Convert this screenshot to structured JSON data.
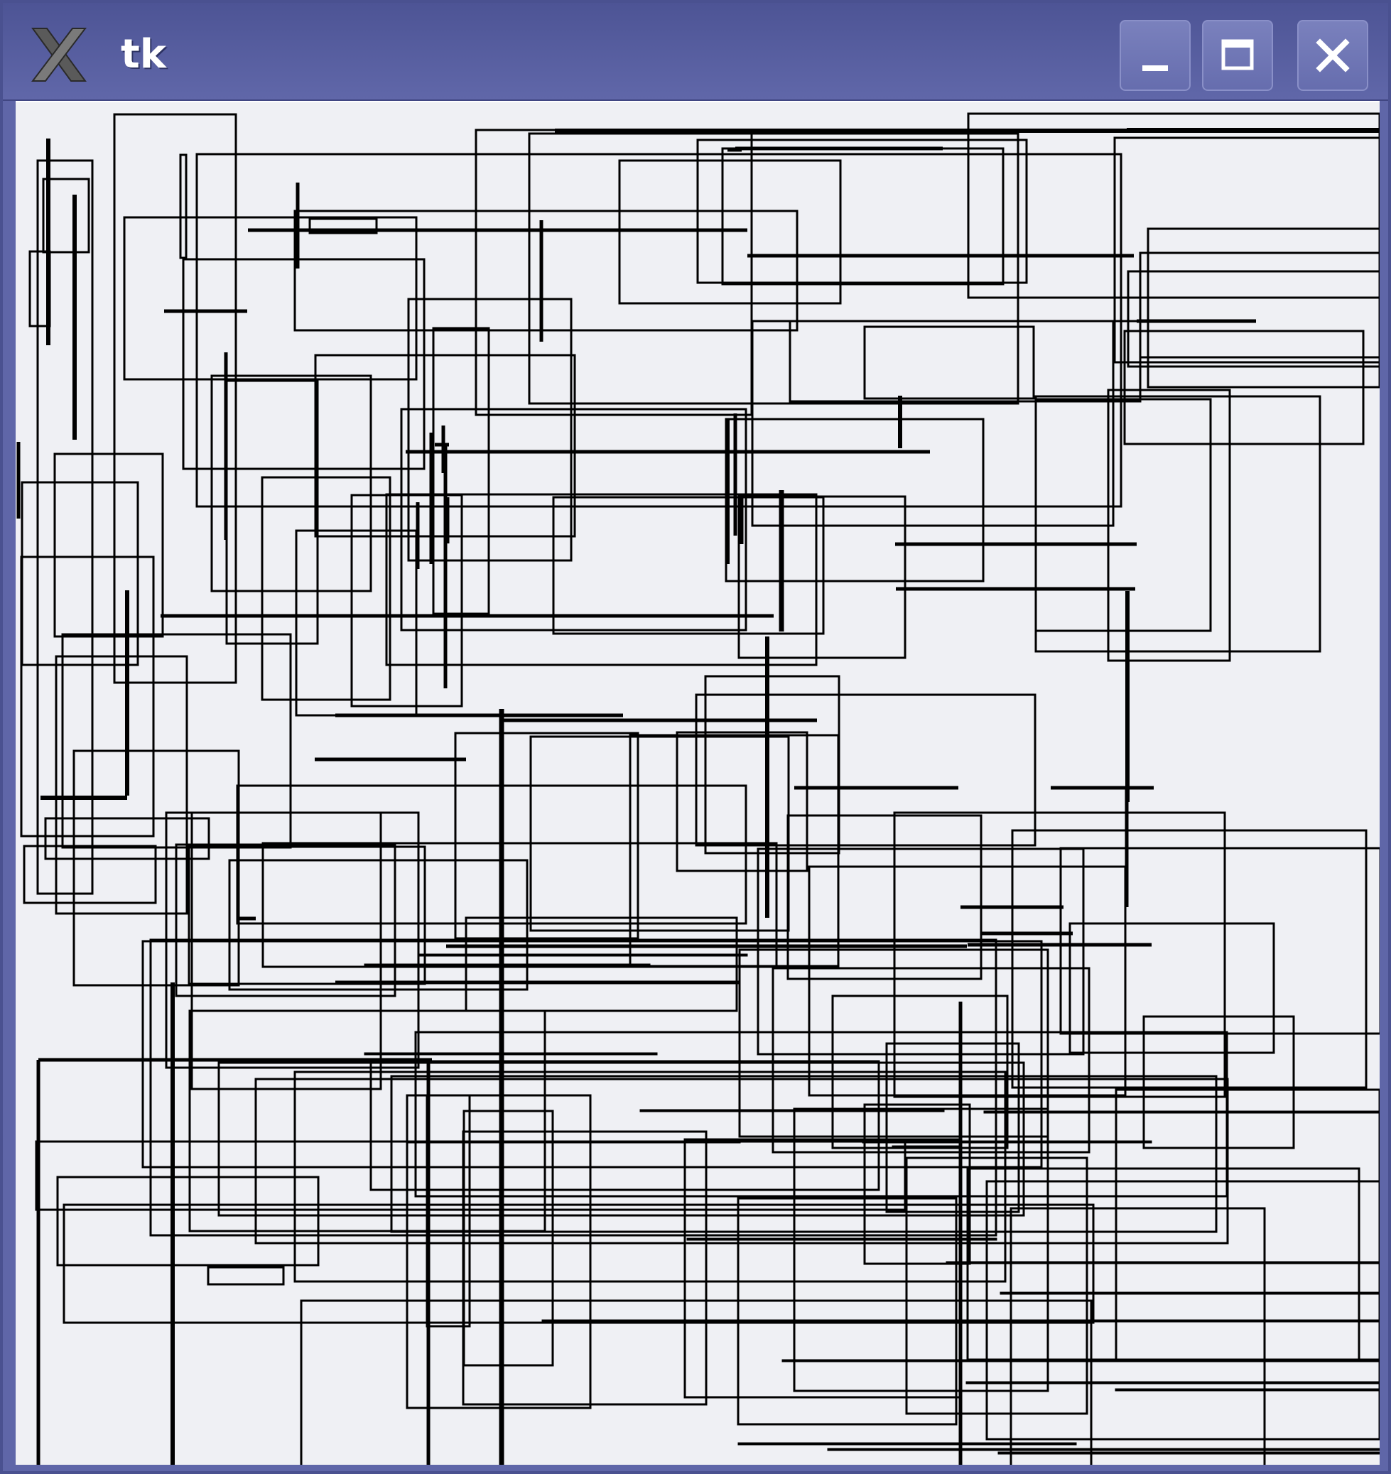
{
  "window": {
    "title": "tk",
    "app_icon": "x-logo-icon",
    "controls": [
      {
        "name": "minimize-button",
        "icon": "minimize-icon"
      },
      {
        "name": "maximize-button",
        "icon": "maximize-icon"
      },
      {
        "name": "close-button",
        "icon": "close-icon"
      }
    ]
  },
  "colors": {
    "titlebar": "#5f66a8",
    "canvas_background": "#eff0f4",
    "stroke": "#000000"
  },
  "canvas": {
    "content": "rectangles",
    "shape_count": 130
  }
}
